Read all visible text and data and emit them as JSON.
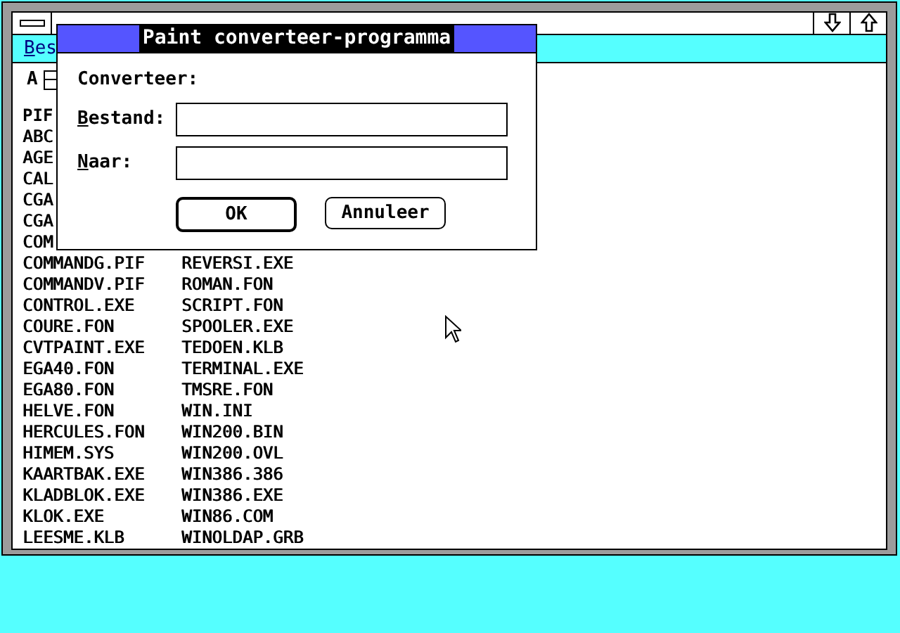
{
  "menu_bar": {
    "items": [
      {
        "label": "Bes"
      }
    ]
  },
  "drive": {
    "label": "A"
  },
  "file_list": {
    "header": "PIF",
    "rows": [
      [
        "ABC",
        ""
      ],
      [
        "AGE",
        ""
      ],
      [
        "CAL",
        ""
      ],
      [
        "CGA",
        ""
      ],
      [
        "CGA",
        ""
      ],
      [
        "COM",
        ""
      ],
      [
        "COMMANDG.PIF",
        "REVERSI.EXE"
      ],
      [
        "COMMANDV.PIF",
        "ROMAN.FON"
      ],
      [
        "CONTROL.EXE",
        "SCRIPT.FON"
      ],
      [
        "COURE.FON",
        "SPOOLER.EXE"
      ],
      [
        "CVTPAINT.EXE",
        "TEDOEN.KLB"
      ],
      [
        "EGA40.FON",
        "TERMINAL.EXE"
      ],
      [
        "EGA80.FON",
        "TMSRE.FON"
      ],
      [
        "HELVE.FON",
        "WIN.INI"
      ],
      [
        "HERCULES.FON",
        "WIN200.BIN"
      ],
      [
        "HIMEM.SYS",
        "WIN200.OVL"
      ],
      [
        "KAARTBAK.EXE",
        "WIN386.386"
      ],
      [
        "KLADBLOK.EXE",
        "WIN386.EXE"
      ],
      [
        "KLOK.EXE",
        "WIN86.COM"
      ],
      [
        "LEESME.KLB",
        "WINOLDAP.GRB"
      ]
    ]
  },
  "dialog": {
    "title": "Paint converteer-programma",
    "heading": "Converteer:",
    "fields": [
      {
        "label": "Bestand:"
      },
      {
        "label": "Naar:"
      }
    ],
    "buttons": [
      {
        "label": "OK",
        "default": true
      },
      {
        "label": "Annuleer",
        "default": false
      }
    ]
  }
}
